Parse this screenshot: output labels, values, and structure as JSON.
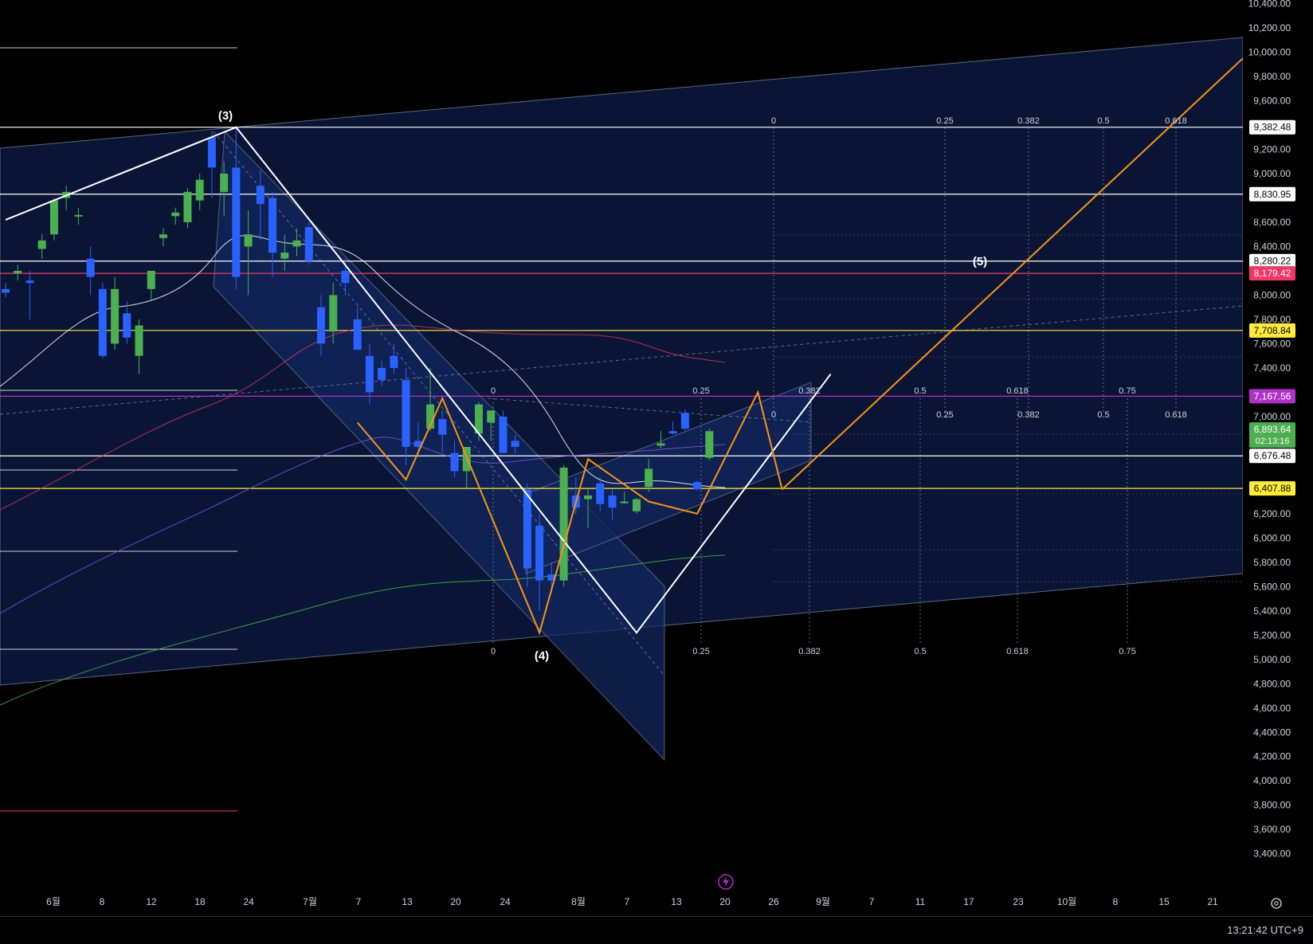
{
  "chart_data": {
    "type": "candlestick",
    "price_axis": {
      "ticks": [
        "10,400.00",
        "10,200.00",
        "10,000.00",
        "9,800.00",
        "9,600.00",
        "9,200.00",
        "9,000.00",
        "8,600.00",
        "8,400.00",
        "8,000.00",
        "7,800.00",
        "7,600.00",
        "7,400.00",
        "7,000.00",
        "6,200.00",
        "6,000.00",
        "5,800.00",
        "5,600.00",
        "5,400.00",
        "5,200.00",
        "5,000.00",
        "4,800.00",
        "4,600.00",
        "4,400.00",
        "4,200.00",
        "4,000.00",
        "3,800.00",
        "3,600.00",
        "3,400.00"
      ],
      "range": [
        3280,
        10430
      ]
    },
    "time_axis": {
      "ticks": [
        "6월",
        "8",
        "12",
        "18",
        "24",
        "7월",
        "7",
        "13",
        "20",
        "24",
        "8월",
        "7",
        "13",
        "20",
        "26",
        "9월",
        "7",
        "11",
        "17",
        "23",
        "10월",
        "8",
        "15",
        "21"
      ]
    },
    "price_labels": [
      {
        "text": "9,382.48",
        "value": 9382.48,
        "bg": "#ffffff",
        "fg": "#000000"
      },
      {
        "text": "8,830.95",
        "value": 8830.95,
        "bg": "#ffffff",
        "fg": "#000000"
      },
      {
        "text": "8,280.22",
        "value": 8280.22,
        "bg": "#ffffff",
        "fg": "#000000"
      },
      {
        "text": "8,179.42",
        "value": 8179.42,
        "bg": "#f23668",
        "fg": "#ffffff"
      },
      {
        "text": "7,708.84",
        "value": 7708.84,
        "bg": "#ffeb3b",
        "fg": "#000000"
      },
      {
        "text": "7,167.56",
        "value": 7167.56,
        "bg": "#b030c8",
        "fg": "#ffffff"
      },
      {
        "text": "6,676.48",
        "value": 6676.48,
        "bg": "#ffffff",
        "fg": "#000000"
      },
      {
        "text": "6,407.88",
        "value": 6407.88,
        "bg": "#ffeb3b",
        "fg": "#000000"
      }
    ],
    "current_price": {
      "price": "6,893.64",
      "countdown": "02:13:16",
      "value": 6893.64,
      "color": "#4caf50"
    },
    "horizontal_lines": [
      {
        "value": 9382.48,
        "color": "#ffffff"
      },
      {
        "value": 8830.95,
        "color": "#ffffff"
      },
      {
        "value": 8280.22,
        "color": "#ffffff"
      },
      {
        "value": 8179.42,
        "color": "#f23668"
      },
      {
        "value": 7708.84,
        "color": "#ffeb3b"
      },
      {
        "value": 7167.56,
        "color": "#b030c8"
      },
      {
        "value": 6676.48,
        "color": "#ffffff"
      },
      {
        "value": 6407.88,
        "color": "#ffeb3b"
      }
    ],
    "wave_labels": [
      "(3)",
      "(4)",
      "(5)"
    ],
    "fib_levels_upper": [
      "0",
      "0.25",
      "0.382",
      "0.5",
      "0.618"
    ],
    "fib_levels_mid": [
      "0",
      "0.25",
      "0.382",
      "0.5",
      "0.618",
      "0.75"
    ],
    "fib_levels_lower": [
      "0",
      "0.25",
      "0.382",
      "0.5",
      "0.618",
      "0.75"
    ],
    "candles": [
      {
        "o": 8050,
        "h": 8100,
        "l": 7980,
        "c": 8020
      },
      {
        "o": 8180,
        "h": 8250,
        "l": 8120,
        "c": 8200
      },
      {
        "o": 8120,
        "h": 8200,
        "l": 7800,
        "c": 8100
      },
      {
        "o": 8380,
        "h": 8500,
        "l": 8300,
        "c": 8450
      },
      {
        "o": 8500,
        "h": 8800,
        "l": 8450,
        "c": 8780
      },
      {
        "o": 8800,
        "h": 8900,
        "l": 8700,
        "c": 8850
      },
      {
        "o": 8650,
        "h": 8720,
        "l": 8580,
        "c": 8660
      },
      {
        "o": 8300,
        "h": 8400,
        "l": 8000,
        "c": 8150
      },
      {
        "o": 8050,
        "h": 8100,
        "l": 7480,
        "c": 7500
      },
      {
        "o": 7600,
        "h": 8150,
        "l": 7550,
        "c": 8050
      },
      {
        "o": 7850,
        "h": 7950,
        "l": 7600,
        "c": 7650
      },
      {
        "o": 7500,
        "h": 7800,
        "l": 7350,
        "c": 7750
      },
      {
        "o": 8050,
        "h": 8150,
        "l": 7950,
        "c": 8200
      },
      {
        "o": 8470,
        "h": 8550,
        "l": 8400,
        "c": 8500
      },
      {
        "o": 8650,
        "h": 8720,
        "l": 8580,
        "c": 8680
      },
      {
        "o": 8600,
        "h": 8880,
        "l": 8550,
        "c": 8850
      },
      {
        "o": 8780,
        "h": 9000,
        "l": 8700,
        "c": 8950
      },
      {
        "o": 9300,
        "h": 9350,
        "l": 8800,
        "c": 9050
      },
      {
        "o": 8850,
        "h": 9100,
        "l": 8650,
        "c": 9000
      },
      {
        "o": 9050,
        "h": 9380,
        "l": 8050,
        "c": 8150
      },
      {
        "o": 8400,
        "h": 8700,
        "l": 8000,
        "c": 8500
      },
      {
        "o": 8900,
        "h": 9030,
        "l": 8450,
        "c": 8750
      },
      {
        "o": 8800,
        "h": 8850,
        "l": 8150,
        "c": 8350
      },
      {
        "o": 8300,
        "h": 8500,
        "l": 8200,
        "c": 8350
      },
      {
        "o": 8400,
        "h": 8550,
        "l": 8320,
        "c": 8450
      },
      {
        "o": 8560,
        "h": 8600,
        "l": 8250,
        "c": 8280
      },
      {
        "o": 7900,
        "h": 8000,
        "l": 7500,
        "c": 7600
      },
      {
        "o": 7700,
        "h": 8100,
        "l": 7600,
        "c": 8000
      },
      {
        "o": 8200,
        "h": 8300,
        "l": 8000,
        "c": 8100
      },
      {
        "o": 7800,
        "h": 7900,
        "l": 7550,
        "c": 7550
      },
      {
        "o": 7500,
        "h": 7600,
        "l": 7100,
        "c": 7200
      },
      {
        "o": 7400,
        "h": 7460,
        "l": 7250,
        "c": 7300
      },
      {
        "o": 7500,
        "h": 7600,
        "l": 7350,
        "c": 7400
      },
      {
        "o": 7300,
        "h": 7400,
        "l": 6600,
        "c": 6750
      },
      {
        "o": 6800,
        "h": 6950,
        "l": 6700,
        "c": 6750
      },
      {
        "o": 6900,
        "h": 7400,
        "l": 6880,
        "c": 7100
      },
      {
        "o": 6980,
        "h": 7050,
        "l": 6700,
        "c": 6850
      },
      {
        "o": 6700,
        "h": 6800,
        "l": 6500,
        "c": 6550
      },
      {
        "o": 6550,
        "h": 6700,
        "l": 6400,
        "c": 6750
      },
      {
        "o": 6860,
        "h": 7120,
        "l": 6800,
        "c": 7100
      },
      {
        "o": 6950,
        "h": 7020,
        "l": 6800,
        "c": 7050
      },
      {
        "o": 7000,
        "h": 7050,
        "l": 6700,
        "c": 6700
      },
      {
        "o": 6800,
        "h": 6850,
        "l": 6700,
        "c": 6750
      },
      {
        "o": 6400,
        "h": 6450,
        "l": 5600,
        "c": 5750
      },
      {
        "o": 6100,
        "h": 6200,
        "l": 5400,
        "c": 5650
      },
      {
        "o": 5700,
        "h": 5800,
        "l": 5550,
        "c": 5650
      },
      {
        "o": 5650,
        "h": 6600,
        "l": 5600,
        "c": 6580
      },
      {
        "o": 6350,
        "h": 6500,
        "l": 6200,
        "c": 6250
      },
      {
        "o": 6320,
        "h": 6400,
        "l": 6080,
        "c": 6350
      },
      {
        "o": 6450,
        "h": 6500,
        "l": 6220,
        "c": 6280
      },
      {
        "o": 6350,
        "h": 6400,
        "l": 6150,
        "c": 6250
      },
      {
        "o": 6300,
        "h": 6380,
        "l": 6280,
        "c": 6300
      },
      {
        "o": 6220,
        "h": 6330,
        "l": 6200,
        "c": 6320
      },
      {
        "o": 6420,
        "h": 6650,
        "l": 6380,
        "c": 6570
      },
      {
        "o": 6760,
        "h": 6880,
        "l": 6740,
        "c": 6780
      },
      {
        "o": 6880,
        "h": 6960,
        "l": 6850,
        "c": 6860
      },
      {
        "o": 7030,
        "h": 7060,
        "l": 6880,
        "c": 6900
      },
      {
        "o": 6460,
        "h": 6470,
        "l": 6390,
        "c": 6400
      },
      {
        "o": 6660,
        "h": 6900,
        "l": 6640,
        "c": 6880
      }
    ],
    "wave_points": [
      {
        "t": 0,
        "v": 8620
      },
      {
        "t": 19,
        "v": 9382
      },
      {
        "t": 52,
        "v": 5220
      },
      {
        "t": 68,
        "v": 7350
      }
    ],
    "orange_zigzag": [
      {
        "t": 29,
        "v": 6950
      },
      {
        "t": 33,
        "v": 6480
      },
      {
        "t": 36,
        "v": 7150
      },
      {
        "t": 44,
        "v": 5220
      },
      {
        "t": 48,
        "v": 6650
      },
      {
        "t": 53,
        "v": 6300
      },
      {
        "t": 57,
        "v": 6200
      },
      {
        "t": 62,
        "v": 7200
      },
      {
        "t": 64,
        "v": 6400
      }
    ],
    "orange_projection": {
      "from": {
        "t": 64,
        "v": 6400
      },
      "to": {
        "t": 102,
        "v": 9950
      }
    },
    "moving_averages": [
      {
        "name": "",
        "color": "#ffffff"
      },
      {
        "name": "",
        "color": "#d83060"
      },
      {
        "name": "",
        "color": "#7a52d8"
      },
      {
        "name": "",
        "color": "#4caf50"
      }
    ]
  },
  "status": {
    "clock": "13:21:42 UTC+9"
  },
  "icons": {
    "settings": "gear-icon",
    "bolt": "lightning-icon"
  }
}
